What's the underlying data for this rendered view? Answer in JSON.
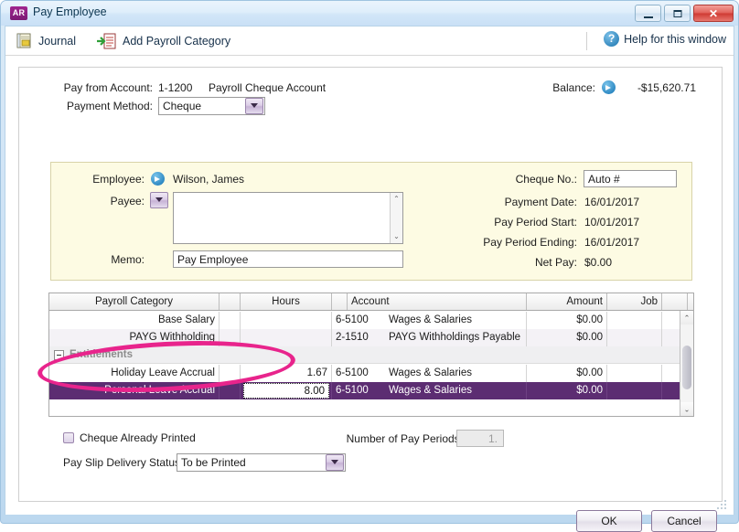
{
  "window": {
    "badge": "AR",
    "title": "Pay Employee",
    "minimize": "–",
    "maximize": "□",
    "close": "✕"
  },
  "toolbar": {
    "journal_label": "Journal",
    "add_payroll_category_label": "Add Payroll Category",
    "help_label": "Help for this window",
    "help_glyph": "?"
  },
  "header": {
    "pay_from_account_label": "Pay from Account:",
    "pay_from_account_code": "1-1200",
    "pay_from_account_name": "Payroll Cheque Account",
    "payment_method_label": "Payment Method:",
    "payment_method_value": "Cheque",
    "balance_label": "Balance:",
    "balance_value": "-$15,620.71"
  },
  "employee": {
    "employee_label": "Employee:",
    "employee_name": "Wilson, James",
    "payee_label": "Payee:",
    "payee_value": "",
    "memo_label": "Memo:",
    "memo_value": "Pay Employee",
    "cheque_no_label": "Cheque No.:",
    "cheque_no_value": "Auto #",
    "payment_date_label": "Payment Date:",
    "payment_date_value": "16/01/2017",
    "pay_period_start_label": "Pay Period Start:",
    "pay_period_start_value": "10/01/2017",
    "pay_period_ending_label": "Pay Period Ending:",
    "pay_period_ending_value": "16/01/2017",
    "net_pay_label": "Net Pay:",
    "net_pay_value": "$0.00"
  },
  "grid": {
    "columns": [
      "Payroll Category",
      "",
      "Hours",
      "",
      "Account",
      "Amount",
      "Job",
      "",
      ""
    ],
    "rows": [
      {
        "category": "Base Salary",
        "hours": "",
        "account_code": "6-5100",
        "account_name": "Wages & Salaries",
        "amount": "$0.00",
        "job": "",
        "selected": false
      },
      {
        "category": "PAYG Withholding",
        "hours": "",
        "account_code": "2-1510",
        "account_name": "PAYG Withholdings Payable",
        "amount": "$0.00",
        "job": "",
        "selected": false
      }
    ],
    "group_label": "Entitlements",
    "entitlement_rows": [
      {
        "category": "Holiday Leave Accrual",
        "hours": "1.67",
        "account_code": "6-5100",
        "account_name": "Wages & Salaries",
        "amount": "$0.00",
        "job": "",
        "selected": false
      },
      {
        "category": "Personal Leave Accrual",
        "hours": "8.00",
        "account_code": "6-5100",
        "account_name": "Wages & Salaries",
        "amount": "$0.00",
        "job": "",
        "selected": true
      }
    ],
    "editing_hours_value": "8.00",
    "scroll_up_glyph": "⌃",
    "scroll_down_glyph": "⌄"
  },
  "footer": {
    "cheque_already_printed_label": "Cheque Already Printed",
    "number_of_pay_periods_label": "Number of Pay Periods:",
    "number_of_pay_periods_value": "1.",
    "pay_slip_delivery_label": "Pay Slip Delivery Status:",
    "pay_slip_delivery_value": "To be Printed",
    "ok_label": "OK",
    "cancel_label": "Cancel"
  },
  "colors": {
    "selection_purple": "#5c2d72",
    "annotation_pink": "#e8248c",
    "accent_blue": "#1173b4",
    "badge_purple": "#a0258f"
  }
}
